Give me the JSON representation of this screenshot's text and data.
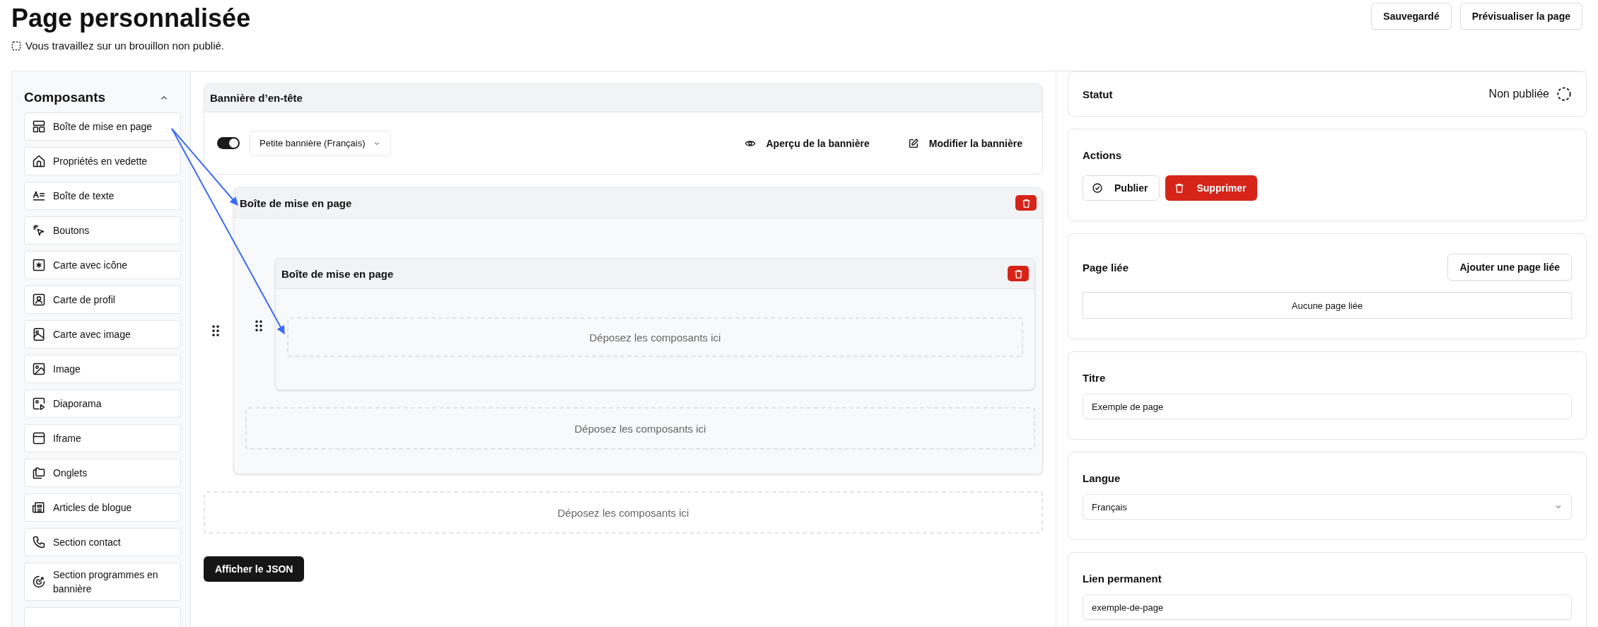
{
  "header": {
    "title": "Page personnalisée",
    "draft_notice": "Vous travaillez sur un brouillon non publié.",
    "buttons": [
      {
        "label": "Sauvegardé"
      },
      {
        "label": "Prévisualiser la page"
      }
    ]
  },
  "components_panel": {
    "title": "Composants",
    "expanded": true,
    "items": [
      {
        "label": "Boîte de mise en page"
      },
      {
        "label": "Propriétés en vedette"
      },
      {
        "label": "Boîte de texte"
      },
      {
        "label": "Boutons"
      },
      {
        "label": "Carte avec icône"
      },
      {
        "label": "Carte de profil"
      },
      {
        "label": "Carte avec image"
      },
      {
        "label": "Image"
      },
      {
        "label": "Diaporama"
      },
      {
        "label": "Iframe"
      },
      {
        "label": "Onglets"
      },
      {
        "label": "Articles de blogue"
      },
      {
        "label": "Section contact"
      },
      {
        "label": "Section programmes en bannière"
      }
    ]
  },
  "banner": {
    "title": "Bannière d’en-tête",
    "enabled": true,
    "select": "Petite bannière (Français)",
    "actions": [
      "Aperçu de la bannière",
      "Modifier la bannière"
    ]
  },
  "layout": {
    "title": "Boîte de mise en page",
    "nested": {
      "title": "Boîte de mise en page",
      "drop_zone": "Déposez les composants ici"
    },
    "drop_zone": "Déposez les composants ici"
  },
  "drop_zone": "Déposez les composants ici",
  "json_button": "Afficher le JSON",
  "status": {
    "title": "Statut",
    "value": "Non publiée"
  },
  "actions": {
    "title": "Actions",
    "buttons": [
      {
        "label": "Publier",
        "kind": "outline"
      },
      {
        "label": "Supprimer",
        "kind": "danger"
      }
    ]
  },
  "linked_page": {
    "title": "Page liée",
    "button": "Ajouter une page liée",
    "empty": "Aucune page liée"
  },
  "title_field": {
    "label": "Titre",
    "value": "Exemple de page"
  },
  "language": {
    "label": "Langue",
    "value": "Français"
  },
  "permalink": {
    "label": "Lien permanent",
    "value": "exemple-de-page"
  }
}
